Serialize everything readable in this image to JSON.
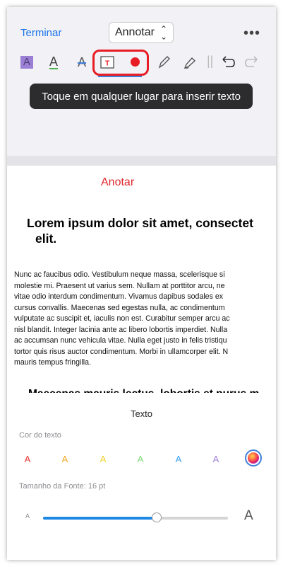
{
  "header": {
    "done_label": "Terminar",
    "mode_label": "Annotar",
    "more_icon": "more-icon"
  },
  "toolbar": {
    "highlight_glyph": "A",
    "underline_glyph": "A",
    "strike_glyph": "A",
    "textbox_glyph": "T",
    "tools": [
      "highlight-text-icon",
      "underline-text-icon",
      "strikethrough-text-icon",
      "text-box-icon",
      "record-icon",
      "pen-icon",
      "highlighter-pen-icon",
      "undo-icon",
      "redo-icon"
    ]
  },
  "tooltip": "Toque em qualquer lugar para inserir texto",
  "document": {
    "label": "Anotar",
    "title_line1": "Lorem ipsum dolor sit amet, consectet",
    "title_line2": "elit.",
    "body": [
      "Nunc ac faucibus odio. Vestibulum neque massa, scelerisque si",
      "molestie mi. Praesent ut varius sem. Nullam at porttitor arcu, ne",
      "vitae odio interdum condimentum. Vivamus dapibus sodales ex",
      "cursus convallis. Maecenas sed egestas nulla, ac condimentum",
      "vulputate ac suscipit et, iaculis non est. Curabitur semper arcu ac",
      "nisl blandit. Integer lacinia ante ac libero lobortis imperdiet. Nulla",
      "ac accumsan nunc vehicula vitae. Nulla eget justo in felis tristiqu",
      "tortor quis risus auctor condimentum. Morbi in ullamcorper elit. N",
      "mauris tempus fringilla."
    ],
    "subtitle": "Maecenas mauris lectus, lobortis et purus m"
  },
  "panel": {
    "title": "Texto",
    "color_label": "Cor do texto",
    "colors": [
      {
        "glyph": "A",
        "color": "#e53935"
      },
      {
        "glyph": "A",
        "color": "#f5a623"
      },
      {
        "glyph": "A",
        "color": "#f2d32a"
      },
      {
        "glyph": "A",
        "color": "#7ed97a"
      },
      {
        "glyph": "A",
        "color": "#3aa0e8"
      },
      {
        "glyph": "A",
        "color": "#a07fd6"
      }
    ],
    "size_label": "Tamanho da Fonte: 16 pt",
    "size_min_glyph": "A",
    "size_max_glyph": "A",
    "size_slider_fraction": 0.616
  }
}
